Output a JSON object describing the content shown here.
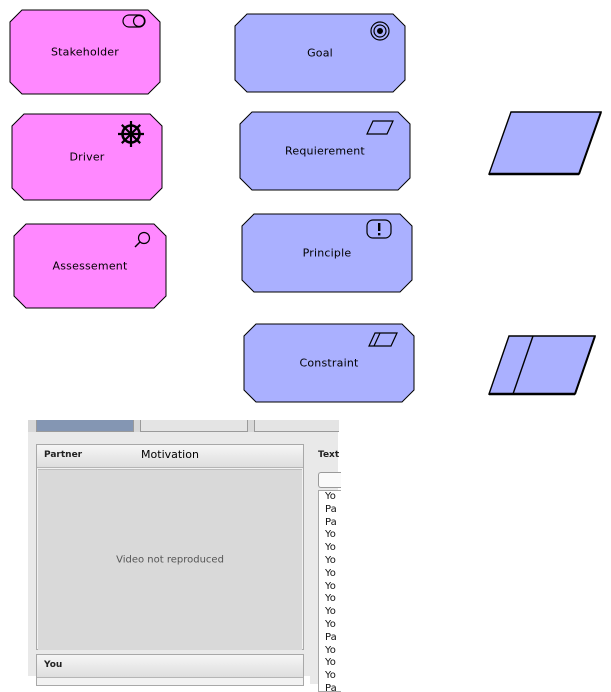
{
  "diagram": {
    "elements": [
      {
        "id": "stakeholder",
        "label": "Stakeholder",
        "group": "motivation-pink",
        "icon": "toggle-icon"
      },
      {
        "id": "driver",
        "label": "Driver",
        "group": "motivation-pink",
        "icon": "ship-wheel-icon"
      },
      {
        "id": "assessement",
        "label": "Assessement",
        "group": "motivation-pink",
        "icon": "magnifier-icon"
      },
      {
        "id": "goal",
        "label": "Goal",
        "group": "motivation-blue",
        "icon": "target-icon"
      },
      {
        "id": "requierement",
        "label": "Requierement",
        "group": "motivation-blue",
        "icon": "parallelogram-icon"
      },
      {
        "id": "principle",
        "label": "Principle",
        "group": "motivation-blue",
        "icon": "exclamation-icon"
      },
      {
        "id": "constraint",
        "label": "Constraint",
        "group": "motivation-blue",
        "icon": "constraint-icon"
      }
    ],
    "notation_shapes": [
      {
        "id": "requirement-shape",
        "kind": "parallelogram"
      },
      {
        "id": "constraint-shape",
        "kind": "parallelogram-split"
      }
    ],
    "colors": {
      "pink_fill": "#ff88ff",
      "blue_fill": "#aab0ff",
      "stroke": "#000000"
    }
  },
  "chat_window": {
    "partner_title": "Partner",
    "video_caption": "Motivation",
    "video_placeholder": "Video not reproduced",
    "you_title": "You",
    "text_title": "Text",
    "chat_lines": [
      "Yo",
      "Pa",
      "Pa",
      "Yo",
      "Yo",
      "Yo",
      "Yo",
      "Yo",
      "Yo",
      "Yo",
      "Yo",
      "Pa",
      "Yo",
      "Yo",
      "Yo",
      "Pa"
    ]
  }
}
